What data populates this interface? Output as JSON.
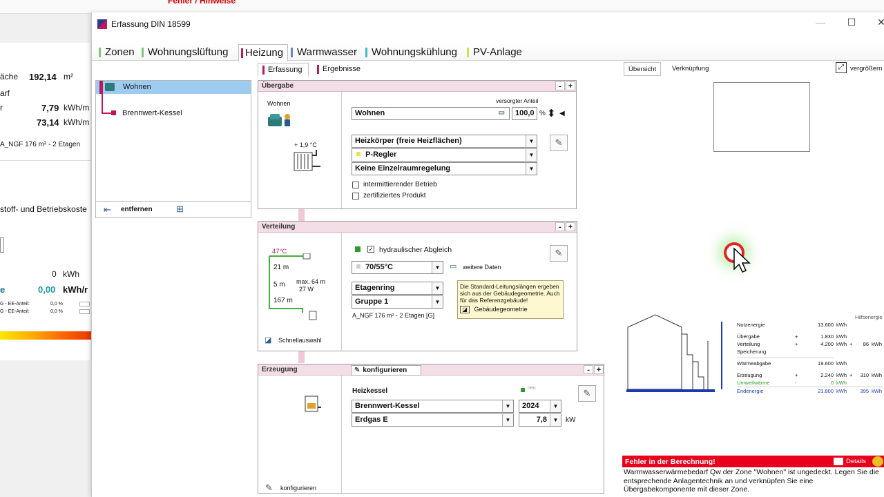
{
  "background": {
    "top_red": "Fehler / Hinweise",
    "rows": {
      "flaeche_label": "äche",
      "flaeche_value": "192,14",
      "flaeche_unit": "m²",
      "bedarf_label": "arf",
      "r_label": "r",
      "val1": "7,79",
      "unit1": "kWh/m",
      "val2": "73,14",
      "unit2": "kWh/m",
      "angf": "A_NGF 176 m²  -  2 Etagen",
      "kosten": "stoff- und Betriebskoste",
      "zero_value": "0",
      "zero_unit": "kWh",
      "e_label": "e",
      "zero2_value": "0,00",
      "zero2_unit": "kWh/r",
      "ee1_label": "G - EE-Anteil:",
      "ee1_value": "0,0 %",
      "ee2_label": "G - EE-Anteil:",
      "ee2_value": "0,0 %"
    }
  },
  "window": {
    "title": "Erfassung DIN 18599",
    "controls": {
      "minimize": "—",
      "maximize": "☐",
      "close": "✕"
    }
  },
  "main_tabs": [
    {
      "label": "Zonen",
      "color": "#7dc77d"
    },
    {
      "label": "Wohnungslüftung",
      "color": "#7dc77d"
    },
    {
      "label": "Heizung",
      "color": "#c0165b"
    },
    {
      "label": "Warmwasser",
      "color": "#7080c0"
    },
    {
      "label": "Wohnungskühlung",
      "color": "#40b8d0"
    },
    {
      "label": "PV-Anlage",
      "color": "#d6e04a"
    }
  ],
  "sub_tabs": {
    "erfassung": "Erfassung",
    "ergebnisse": "Ergebnisse"
  },
  "tree": {
    "items": [
      {
        "label": "Wohnen"
      },
      {
        "label": "Brennwert-Kessel"
      }
    ],
    "remove_label": "entfernen"
  },
  "uebergabe": {
    "title": "Übergabe",
    "icon_label": "Wohnen",
    "temp": "+ 1,9 °C",
    "share_label": "versorgter Anteil",
    "zone": "Wohnen",
    "share_value": "100,0",
    "share_unit": "%",
    "type": "Heizkörper (freie Heizflächen)",
    "regler": "P-Regler",
    "einzelraum": "Keine Einzelraumregelung",
    "cb_intermittierend": "intermittierender Betrieb",
    "cb_zertifiziert": "zertifiziertes Produkt"
  },
  "verteilung": {
    "title": "Verteilung",
    "temp": "47°C",
    "len1": "21 m",
    "len2": "5 m",
    "len3": "167 m",
    "max": "max. 64 m",
    "watt": "27 W",
    "abgleich": "hydraulischer Abgleich",
    "system_temp": "70/55°C",
    "weitere": "weitere Daten",
    "ring": "Etagenring",
    "gruppe": "Gruppe 1",
    "angf": "A_NGF 176 m²  -  2 Etagen  [G]",
    "schnell": "Schnellauswahl",
    "info": "Die Standard-Leitungslängen ergeben sich aus der Gebäudegeometrie. Auch für das Referenzgebäude!",
    "geom": "Gebäudegeometrie"
  },
  "erzeugung": {
    "title": "Erzeugung",
    "konfig_btn": "konfigurieren",
    "heizkessel": "Heizkessel",
    "neu": "neu",
    "kessel": "Brennwert-Kessel",
    "year": "2024",
    "fuel": "Erdgas E",
    "kw_value": "7,8",
    "kw_unit": "kW",
    "konfig_bottom": "konfigurieren"
  },
  "overview": {
    "tab_uebersicht": "Übersicht",
    "tab_verknuepfung": "Verknüpfung",
    "enlarge": "vergrößern",
    "hilfsenergie": "Hilfsenergie",
    "rows": [
      {
        "label": "Nutzenergie",
        "sign": "",
        "value": "13.600",
        "unit": "kWh",
        "h_sign": "",
        "h_value": "",
        "h_unit": ""
      },
      {
        "label": "Übergabe",
        "sign": "+",
        "value": "1.830",
        "unit": "kWh",
        "h_sign": "",
        "h_value": "",
        "h_unit": ""
      },
      {
        "label": "Verteilung",
        "sign": "+",
        "value": "4.200",
        "unit": "kWh",
        "h_sign": "+",
        "h_value": "86",
        "h_unit": "kWh"
      },
      {
        "label": "Speicherung",
        "sign": "",
        "value": "",
        "unit": "",
        "h_sign": "",
        "h_value": "",
        "h_unit": ""
      },
      {
        "label": "Wärmeabgabe",
        "sign": "",
        "value": "19.600",
        "unit": "kWh",
        "h_sign": "",
        "h_value": "",
        "h_unit": ""
      },
      {
        "label": "Erzeugung",
        "sign": "+",
        "value": "2.240",
        "unit": "kWh",
        "h_sign": "+",
        "h_value": "310",
        "h_unit": "kWh"
      },
      {
        "label": "Umweltwärme",
        "sign": "-",
        "value": "0",
        "unit": "kWh",
        "h_sign": "",
        "h_value": "",
        "h_unit": ""
      },
      {
        "label": "Endenergie",
        "sign": "",
        "value": "21.800",
        "unit": "kWh",
        "h_sign": "",
        "h_value": "395",
        "h_unit": "kWh"
      }
    ],
    "colors": {
      "green": "#2e9a2e",
      "blue": "#1a3ab0"
    }
  },
  "error": {
    "title": "Fehler in der Berechnung!",
    "details": "Details",
    "text": "Warmwasserwärmebedarf Qw der Zone \"Wohnen\" ist ungedeckt. Legen Sie die entsprechende Anlagentechnik an und verknüpfen Sie eine Übergabekomponente mit dieser Zone."
  }
}
